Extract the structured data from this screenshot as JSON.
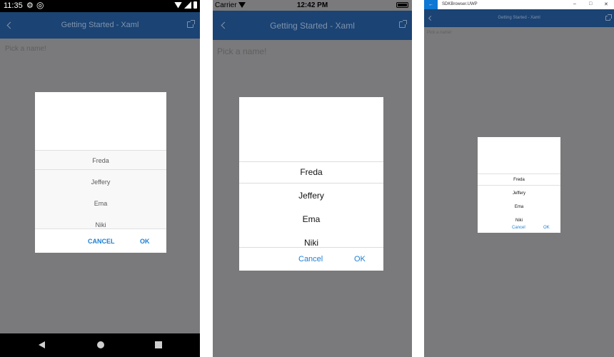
{
  "android": {
    "status_time": "11:35",
    "nav_title": "Getting Started - Xaml",
    "placeholder": "Pick a name!",
    "items": [
      "Freda",
      "Jeffery",
      "Ema",
      "Niki"
    ],
    "cancel_label": "CANCEL",
    "ok_label": "OK"
  },
  "ios": {
    "carrier": "Carrier",
    "status_time": "12:42 PM",
    "nav_title": "Getting Started - Xaml",
    "placeholder": "Pick a name!",
    "items": [
      "Freda",
      "Jeffery",
      "Ema",
      "Niki"
    ],
    "cancel_label": "Cancel",
    "ok_label": "OK"
  },
  "uwp": {
    "app_title": "SDKBrowser.UWP",
    "nav_title": "Getting Started - Xaml",
    "placeholder": "Pick a name!",
    "items": [
      "Freda",
      "Jeffery",
      "Ema",
      "Niki"
    ],
    "cancel_label": "Cancel",
    "ok_label": "OK"
  },
  "colors": {
    "accent": "#1c7fd4",
    "nav_bar": "#1b4373",
    "overlay": "#7a7a7c"
  }
}
